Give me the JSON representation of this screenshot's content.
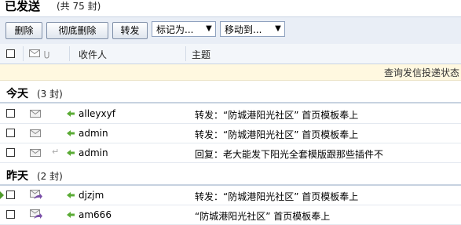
{
  "header": {
    "title": "已发送",
    "count": "(共 75 封)"
  },
  "toolbar": {
    "delete_label": "删除",
    "delete_all_label": "彻底删除",
    "forward_label": "转发",
    "mark_label": "标记为...",
    "move_label": "移动到..."
  },
  "columns": {
    "recipient": "收件人",
    "subject": "主题"
  },
  "notice": {
    "link": "查询发信投递状态"
  },
  "groups": [
    {
      "label": "今天",
      "count": "(3 封)",
      "rows": [
        {
          "recipient": "alleyxyf",
          "subject": "转发：“防城港阳光社区” 首页模板奉上",
          "status": "sent"
        },
        {
          "recipient": "admin",
          "subject": "转发：“防城港阳光社区” 首页模板奉上",
          "status": "sent"
        },
        {
          "recipient": "admin",
          "subject": "回复：老大能发下阳光全套模版跟那些插件不",
          "status": "replied"
        }
      ]
    },
    {
      "label": "昨天",
      "count": "(2 封)",
      "rows": [
        {
          "recipient": "djzjm",
          "subject": "转发：“防城港阳光社区” 首页模板奉上",
          "status": "forwarded"
        },
        {
          "recipient": "am666",
          "subject": "“防城港阳光社区” 首页模板奉上",
          "status": "forwarded"
        }
      ]
    }
  ],
  "colors": {
    "toolbar_bg": "#e9eef6",
    "notice_bg": "#fff8e0",
    "sent_icon": "#4e9a2a",
    "forward_icon": "#7a4fa8"
  }
}
